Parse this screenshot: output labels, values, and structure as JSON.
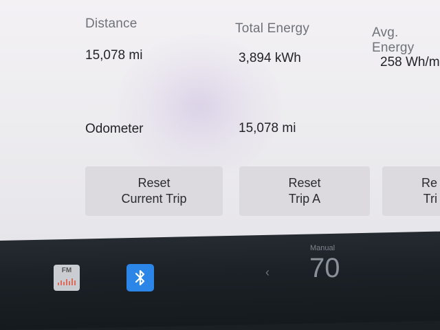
{
  "trip": {
    "distance_label": "Distance",
    "distance_value": "15,078 mi",
    "energy_label": "Total Energy",
    "energy_value": "3,894 kWh",
    "avg_label": "Avg. Energy",
    "avg_value": "258 Wh/m"
  },
  "odometer": {
    "label": "Odometer",
    "value": "15,078 mi"
  },
  "buttons": {
    "reset_current_line1": "Reset",
    "reset_current_line2": "Current Trip",
    "reset_a_line1": "Reset",
    "reset_a_line2": "Trip A",
    "reset_b_line1": "Re",
    "reset_b_line2": "Tri"
  },
  "taskbar": {
    "fm_label": "FM",
    "speed_caption": "Manual",
    "speed_value": "70",
    "arrow_glyph": "‹"
  },
  "colors": {
    "bluetooth": "#2c86e8",
    "screen_bg": "#eeedf0",
    "taskbar_bg": "#1b2126"
  },
  "icons": [
    "fm-radio-icon",
    "bluetooth-icon",
    "chevron-left-icon"
  ]
}
